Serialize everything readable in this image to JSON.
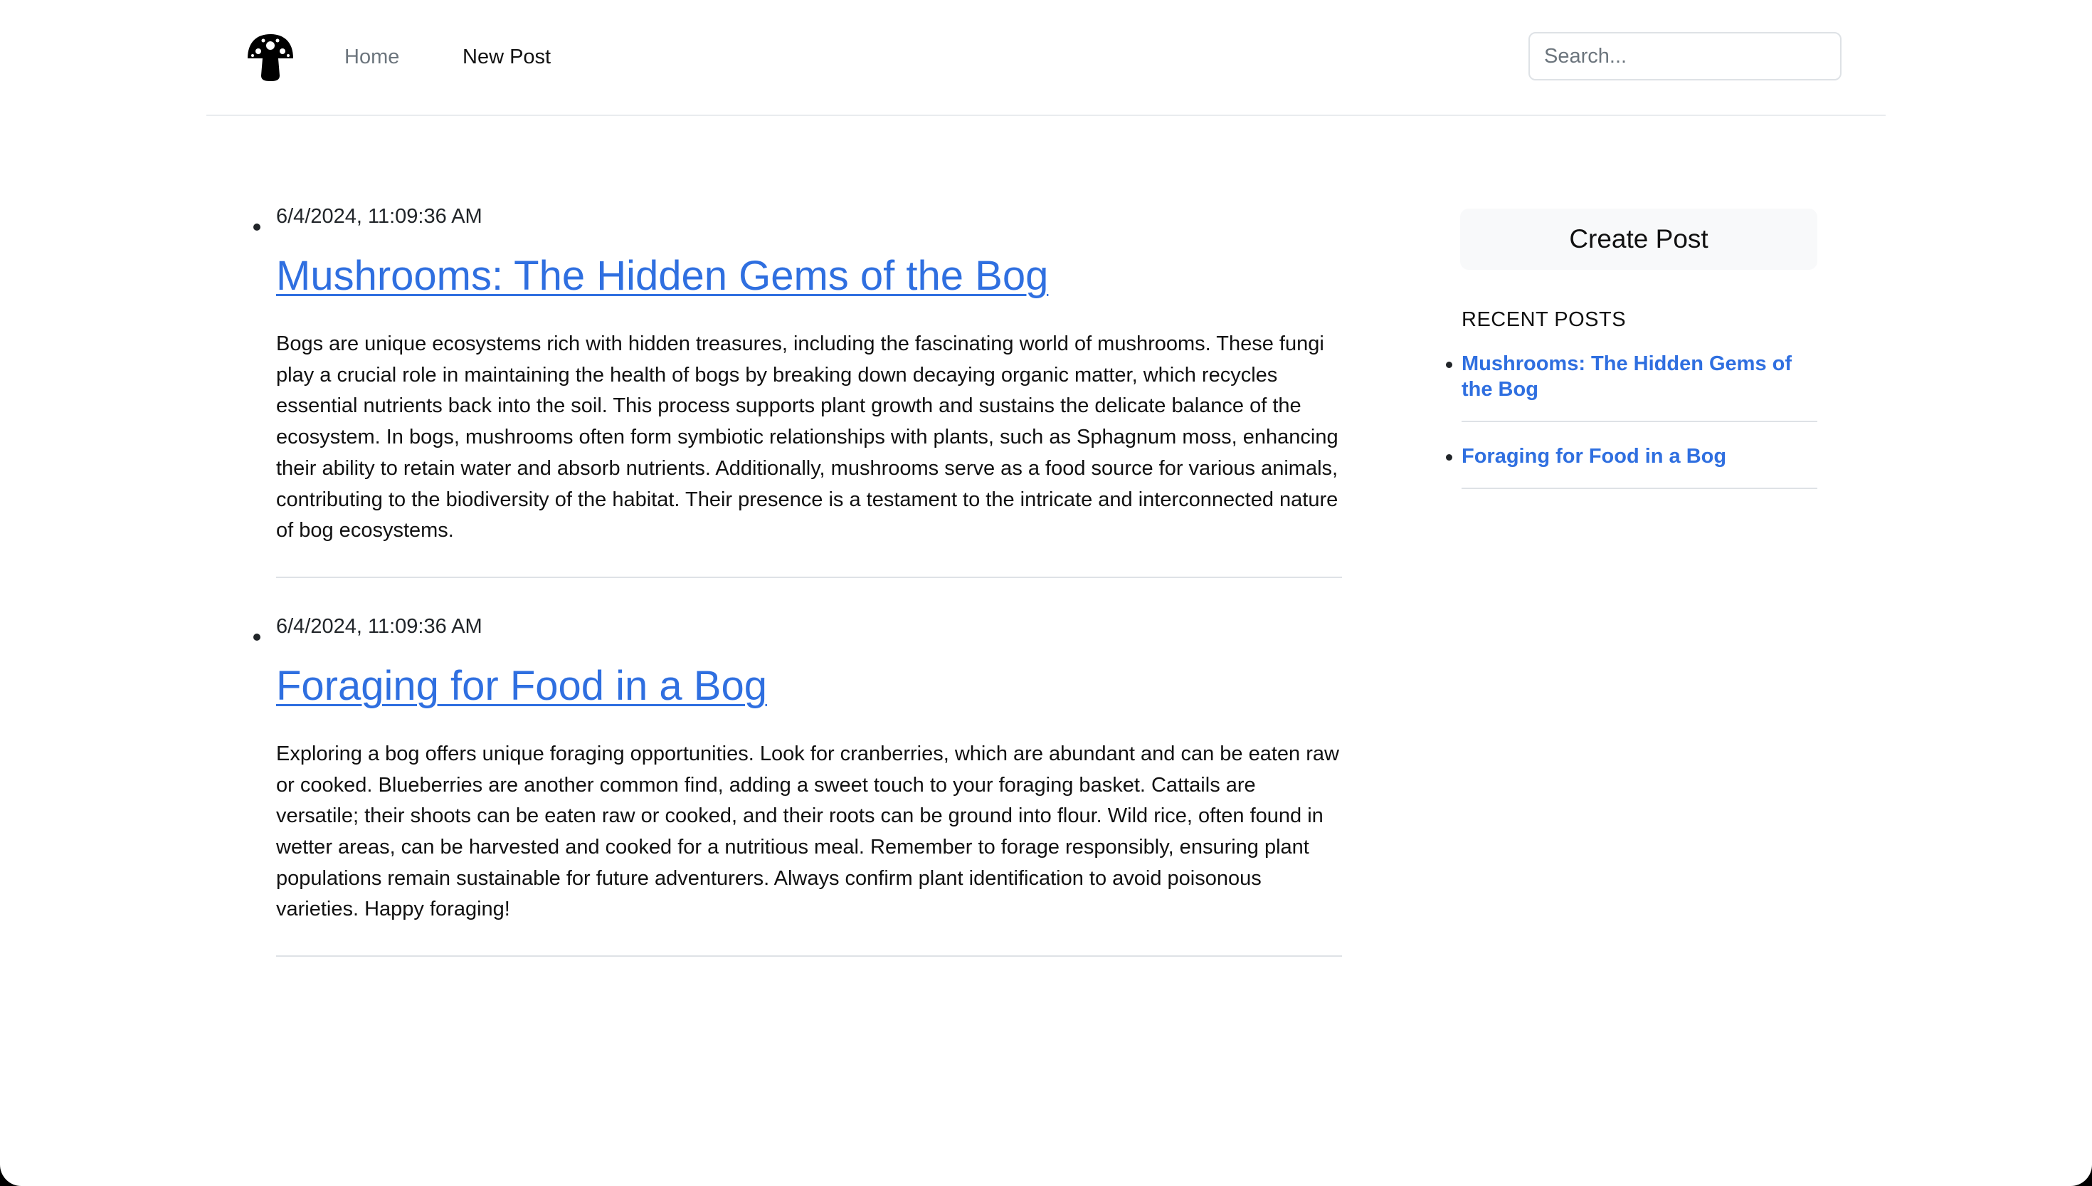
{
  "header": {
    "logo_icon": "mushroom-icon",
    "nav": [
      {
        "label": "Home"
      },
      {
        "label": "New Post"
      }
    ],
    "search": {
      "placeholder": "Search...",
      "value": ""
    }
  },
  "posts": [
    {
      "date": "6/4/2024, 11:09:36 AM",
      "title": "Mushrooms: The Hidden Gems of the Bog",
      "body": "Bogs are unique ecosystems rich with hidden treasures, including the fascinating world of mushrooms. These fungi play a crucial role in maintaining the health of bogs by breaking down decaying organic matter, which recycles essential nutrients back into the soil. This process supports plant growth and sustains the delicate balance of the ecosystem. In bogs, mushrooms often form symbiotic relationships with plants, such as Sphagnum moss, enhancing their ability to retain water and absorb nutrients. Additionally, mushrooms serve as a food source for various animals, contributing to the biodiversity of the habitat. Their presence is a testament to the intricate and interconnected nature of bog ecosystems."
    },
    {
      "date": "6/4/2024, 11:09:36 AM",
      "title": "Foraging for Food in a Bog",
      "body": "Exploring a bog offers unique foraging opportunities. Look for cranberries, which are abundant and can be eaten raw or cooked. Blueberries are another common find, adding a sweet touch to your foraging basket. Cattails are versatile; their shoots can be eaten raw or cooked, and their roots can be ground into flour. Wild rice, often found in wetter areas, can be harvested and cooked for a nutritious meal. Remember to forage responsibly, ensuring plant populations remain sustainable for future adventurers. Always confirm plant identification to avoid poisonous varieties. Happy foraging!"
    }
  ],
  "sidebar": {
    "create_label": "Create Post",
    "recent_heading": "RECENT POSTS",
    "recent": [
      {
        "label": "Mushrooms: The Hidden Gems of the Bog"
      },
      {
        "label": "Foraging for Food in a Bog"
      }
    ]
  },
  "colors": {
    "link": "#2f6fe0",
    "text": "#212529",
    "muted": "#6c757d",
    "button_bg": "#f8f9fa",
    "divider": "#dee2e6"
  }
}
